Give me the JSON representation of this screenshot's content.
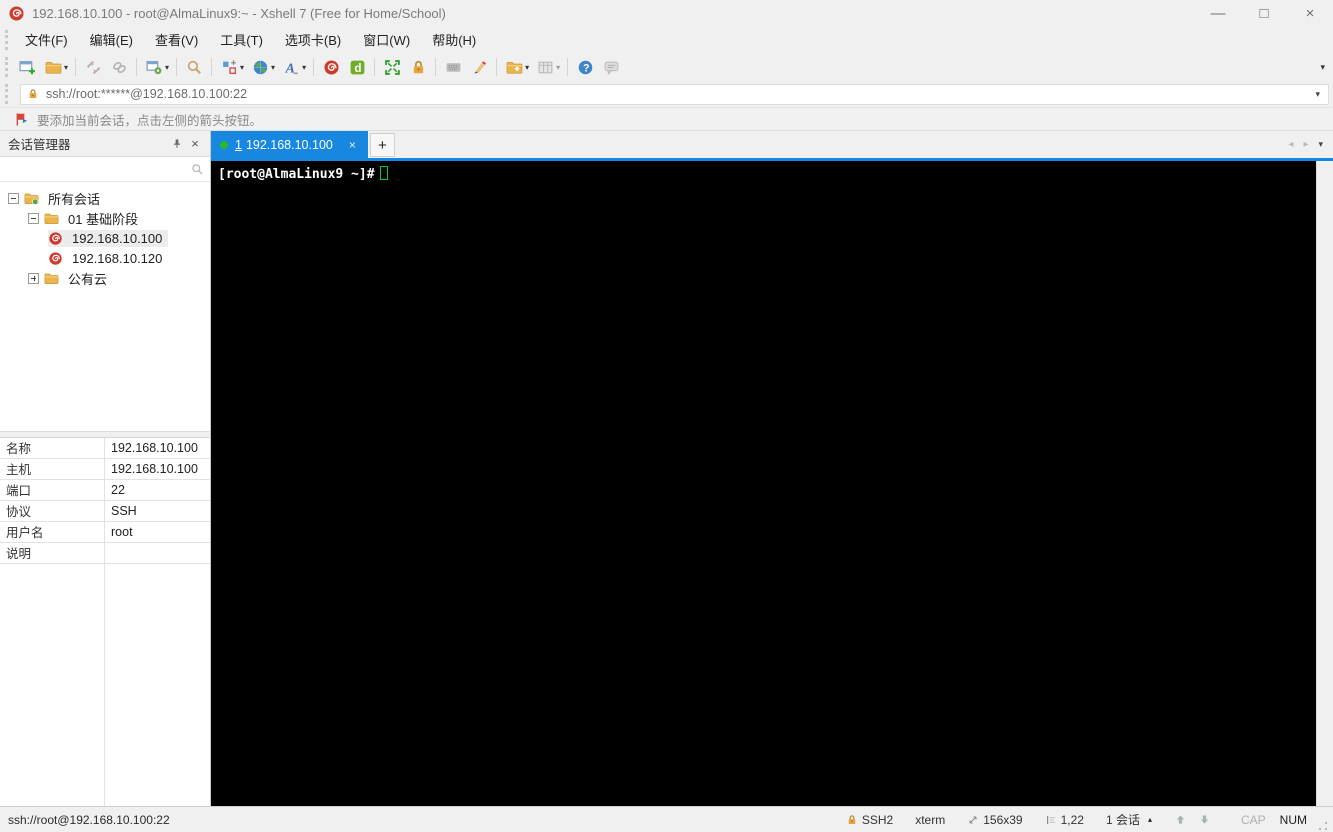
{
  "colors": {
    "accent_blue": "#1787e0",
    "terminal_background": "#000000",
    "terminal_cursor_green": "#00cc33",
    "xshell_red": "#cf3a2e",
    "folder_tan": "#ecb54b",
    "connected_dot_green": "#2db52d"
  },
  "window": {
    "title": "192.168.10.100 - root@AlmaLinux9:~ - Xshell 7 (Free for Home/School)",
    "controls": {
      "minimize": "—",
      "maximize": "□",
      "close": "×"
    }
  },
  "menu_bar": {
    "items": [
      {
        "label": "文件(F)"
      },
      {
        "label": "编辑(E)"
      },
      {
        "label": "查看(V)"
      },
      {
        "label": "工具(T)"
      },
      {
        "label": "选项卡(B)"
      },
      {
        "label": "窗口(W)"
      },
      {
        "label": "帮助(H)"
      }
    ]
  },
  "toolbar": {
    "icons": [
      "new-session",
      "open-session",
      "disconnect",
      "reconnect",
      "session-properties",
      "find",
      "compose-layout",
      "encoding-globe",
      "font",
      "xshell",
      "xftp",
      "fullscreen",
      "lock-screen",
      "virtual-keyboard",
      "highlight-pen",
      "new-terminal-folder",
      "quick-command-grid",
      "help",
      "feedback-chat"
    ]
  },
  "address_bar": {
    "value": "ssh://root:******@192.168.10.100:22"
  },
  "notification_bar": {
    "text": "要添加当前会话，点击左侧的箭头按钮。"
  },
  "session_manager": {
    "title": "会话管理器",
    "search_placeholder": "",
    "tree": [
      {
        "label": "所有会话",
        "level": 0,
        "expanded": true,
        "type": "root-folder"
      },
      {
        "label": "01 基础阶段",
        "level": 1,
        "expanded": true,
        "type": "folder"
      },
      {
        "label": "192.168.10.100",
        "level": 2,
        "type": "session",
        "selected": true
      },
      {
        "label": "192.168.10.120",
        "level": 2,
        "type": "session",
        "selected": false
      },
      {
        "label": "公有云",
        "level": 1,
        "expanded": false,
        "type": "folder"
      }
    ],
    "properties": [
      {
        "label": "名称",
        "value": "192.168.10.100"
      },
      {
        "label": "主机",
        "value": "192.168.10.100"
      },
      {
        "label": "端口",
        "value": "22"
      },
      {
        "label": "协议",
        "value": "SSH"
      },
      {
        "label": "用户名",
        "value": "root"
      },
      {
        "label": "说明",
        "value": ""
      }
    ]
  },
  "tab_bar": {
    "active_tab": {
      "index": "1",
      "label": "192.168.10.100",
      "close": "×"
    },
    "new_tab": "+"
  },
  "terminal": {
    "prompt": "[root@AlmaLinux9 ~]#"
  },
  "status_bar": {
    "left": "ssh://root@192.168.10.100:22",
    "protocol": "SSH2",
    "term_type": "xterm",
    "size": "156x39",
    "cursor_pos": "1,22",
    "session_count": "1 会话",
    "cap": "CAP",
    "num": "NUM"
  }
}
